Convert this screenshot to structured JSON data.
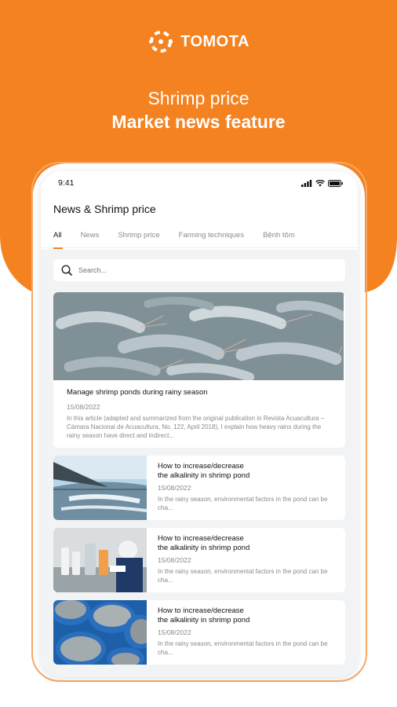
{
  "brand": {
    "name": "TOMOTA"
  },
  "headline": {
    "line1": "Shrimp price",
    "line2": "Market news feature"
  },
  "statusbar": {
    "time": "9:41"
  },
  "app": {
    "title": "News & Shrimp price"
  },
  "tabs": [
    {
      "label": "All",
      "active": true
    },
    {
      "label": "News"
    },
    {
      "label": "Shrimp price"
    },
    {
      "label": "Farming techniques"
    },
    {
      "label": "Bệnh tôm"
    }
  ],
  "search": {
    "placeholder": "Search..."
  },
  "featured": {
    "title": "Manage shrimp ponds during rainy season",
    "date": "15/08/2022",
    "excerpt": "In this article (adapted and summarized from the original publication in Revista Acuacultura – Cámara Nacional de Acuacultura, No. 122, April 2018), I explain how heavy rains during the rainy season have direct and indirect..."
  },
  "articles": [
    {
      "title_line1": "How to increase/decrease",
      "title_line2": "the alkalinity in shrimp pond",
      "date": "15/08/2022",
      "excerpt": "In the rainy season, environmental factors in the pond can be cha..."
    },
    {
      "title_line1": "How to increase/decrease",
      "title_line2": "the alkalinity in shrimp pond",
      "date": "15/08/2022",
      "excerpt": "In the rainy season, environmental factors in the pond can be cha..."
    },
    {
      "title_line1": "How to increase/decrease",
      "title_line2": "the alkalinity in shrimp pond",
      "date": "15/08/2022",
      "excerpt": "In the rainy season, environmental factors in the pond can be cha..."
    }
  ],
  "colors": {
    "brand_orange": "#f58220",
    "text_dark": "#111111",
    "text_muted": "#888888"
  },
  "icons": {
    "logo": "tomota-logo-icon",
    "search": "search-icon",
    "signal": "signal-icon",
    "wifi": "wifi-icon",
    "battery": "battery-icon"
  }
}
